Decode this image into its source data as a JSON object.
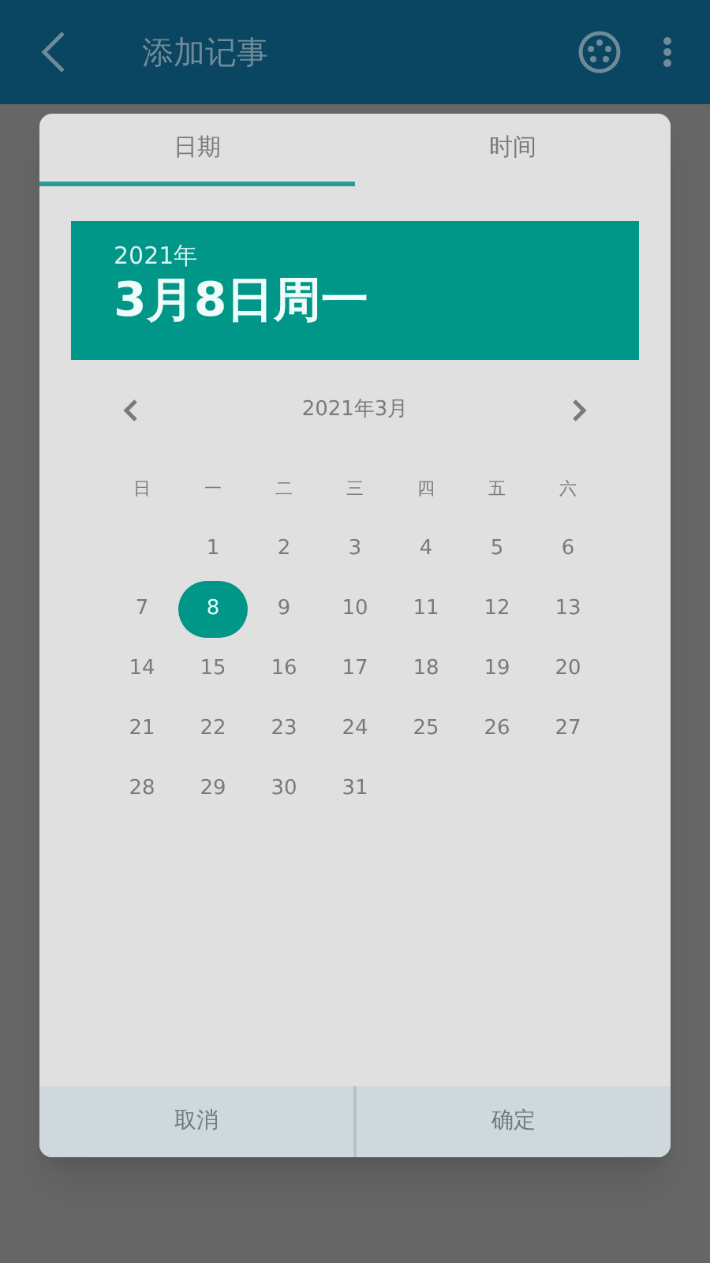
{
  "app_bar": {
    "title": "添加记事"
  },
  "tabs": [
    {
      "label": "日期",
      "selected": true
    },
    {
      "label": "时间",
      "selected": false
    }
  ],
  "header": {
    "year": "2021年",
    "date": "3月8日周一"
  },
  "calendar": {
    "month": "2021年3月",
    "weekdays": [
      "日",
      "一",
      "二",
      "三",
      "四",
      "五",
      "六"
    ],
    "weeks": [
      {
        "days": [
          {
            "label": "1",
            "selected": false
          },
          {
            "label": "2",
            "selected": false
          },
          {
            "label": "3",
            "selected": false
          },
          {
            "label": "4",
            "selected": false
          },
          {
            "label": "5",
            "selected": false
          },
          {
            "label": "6",
            "selected": false
          }
        ]
      },
      {
        "days": [
          {
            "label": "7",
            "selected": false
          },
          {
            "label": "8",
            "selected": true
          },
          {
            "label": "9",
            "selected": false
          },
          {
            "label": "10",
            "selected": false
          },
          {
            "label": "11",
            "selected": false
          },
          {
            "label": "12",
            "selected": false
          },
          {
            "label": "13",
            "selected": false
          }
        ]
      },
      {
        "days": [
          {
            "label": "14",
            "selected": false
          },
          {
            "label": "15",
            "selected": false
          },
          {
            "label": "16",
            "selected": false
          },
          {
            "label": "17",
            "selected": false
          },
          {
            "label": "18",
            "selected": false
          },
          {
            "label": "19",
            "selected": false
          },
          {
            "label": "20",
            "selected": false
          }
        ]
      },
      {
        "days": [
          {
            "label": "21",
            "selected": false
          },
          {
            "label": "22",
            "selected": false
          },
          {
            "label": "23",
            "selected": false
          },
          {
            "label": "24",
            "selected": false
          },
          {
            "label": "25",
            "selected": false
          },
          {
            "label": "26",
            "selected": false
          },
          {
            "label": "27",
            "selected": false
          }
        ]
      },
      {
        "days": [
          {
            "label": "28",
            "selected": false
          },
          {
            "label": "29",
            "selected": false
          },
          {
            "label": "30",
            "selected": false
          },
          {
            "label": "31",
            "selected": false
          }
        ]
      }
    ]
  },
  "buttons": [
    "取消",
    "确定"
  ]
}
